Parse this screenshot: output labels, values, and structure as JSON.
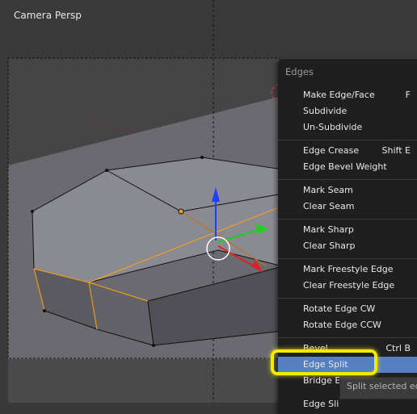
{
  "viewport": {
    "title": "Camera Persp"
  },
  "menu": {
    "title": "Edges",
    "items": [
      {
        "label": "Make Edge/Face",
        "shortcut": "F"
      },
      {
        "label": "Subdivide",
        "shortcut": ""
      },
      {
        "label": "Un-Subdivide",
        "shortcut": ""
      },
      {
        "label": "Edge Crease",
        "shortcut": "Shift E"
      },
      {
        "label": "Edge Bevel Weight",
        "shortcut": ""
      },
      {
        "label": "Mark Seam",
        "shortcut": ""
      },
      {
        "label": "Clear Seam",
        "shortcut": ""
      },
      {
        "label": "Mark Sharp",
        "shortcut": ""
      },
      {
        "label": "Clear Sharp",
        "shortcut": ""
      },
      {
        "label": "Mark Freestyle Edge",
        "shortcut": ""
      },
      {
        "label": "Clear Freestyle Edge",
        "shortcut": ""
      },
      {
        "label": "Rotate Edge CW",
        "shortcut": ""
      },
      {
        "label": "Rotate Edge CCW",
        "shortcut": ""
      },
      {
        "label": "Bevel",
        "shortcut": "Ctrl B"
      },
      {
        "label": "Edge Split",
        "shortcut": ""
      },
      {
        "label": "Bridge E",
        "shortcut": ""
      },
      {
        "label": "Edge Sli",
        "shortcut": ""
      }
    ],
    "active_item": "Edge Split"
  },
  "tooltip": {
    "text": "Split selected edg"
  },
  "colors": {
    "selection_highlight": "#f3ea00",
    "active_item": "#5680c2",
    "selected_edge": "#f0a020"
  }
}
